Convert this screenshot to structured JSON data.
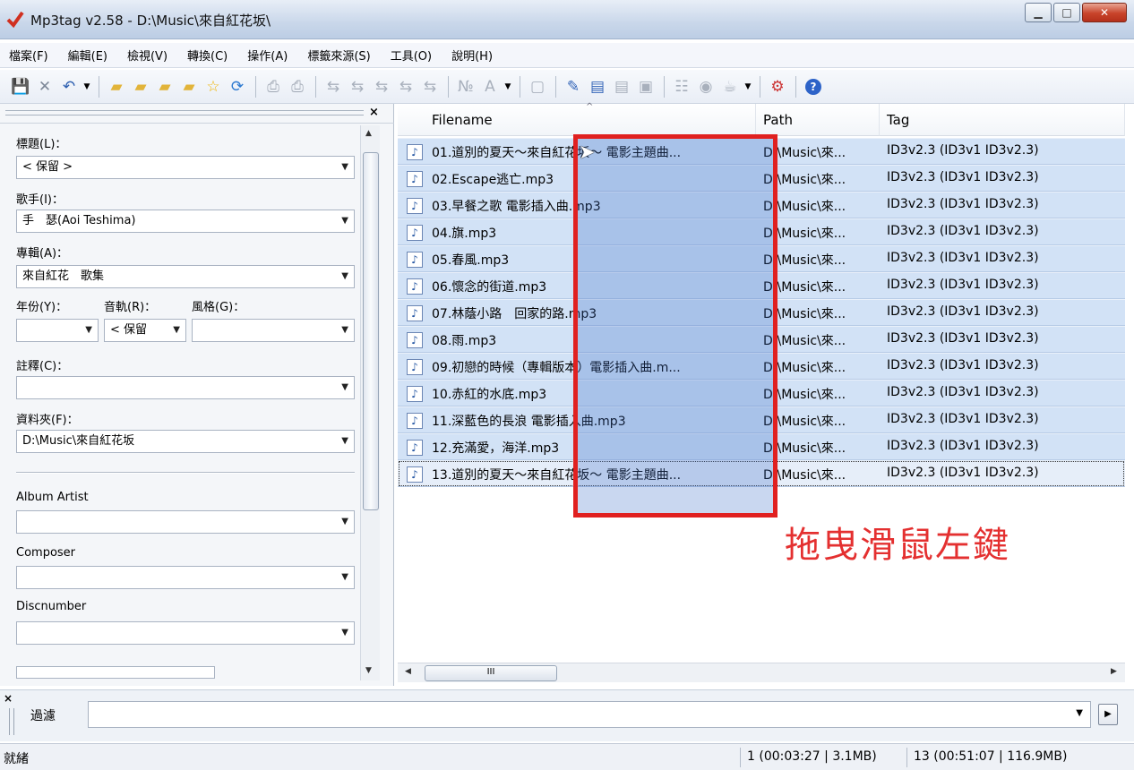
{
  "window": {
    "title": "Mp3tag v2.58  -  D:\\Music\\來自紅花坂\\",
    "minimize": "▁",
    "maximize": "□",
    "close": "✕"
  },
  "menu": [
    "檔案(F)",
    "編輯(E)",
    "檢視(V)",
    "轉換(C)",
    "操作(A)",
    "標籤來源(S)",
    "工具(O)",
    "說明(H)"
  ],
  "toolbar_icons": [
    "save-icon",
    "remove-tag-icon",
    "undo-icon",
    "undo-dropdown-icon",
    "change-directory-icon",
    "add-directory-icon",
    "open-folder-icon",
    "add-folder-icon",
    "favorites-icon",
    "refresh-icon",
    "print-icon",
    "print2-icon",
    "tag-filename-icon",
    "filename-tag-icon",
    "filename-filename-icon",
    "text-file-tag-icon",
    "tag-tag-icon",
    "autonumber-icon",
    "case-conversion-icon",
    "case-dropdown-icon",
    "extended-tags-icon",
    "actions-icon",
    "export-icon",
    "import-icon",
    "playlist-icon",
    "web-source-icon",
    "cd-icon",
    "coffee-icon",
    "coffee-dropdown-icon",
    "options-icon",
    "help-icon"
  ],
  "left_panel": {
    "close": "×",
    "title_label": "標題(L)：",
    "title_value": "< 保留 >",
    "artist_label": "歌手(I)：",
    "artist_value": "手　瑟(Aoi Teshima)",
    "album_label": "專輯(A)：",
    "album_value": "來自紅花　歌集",
    "year_label": "年份(Y)：",
    "track_label": "音軌(R)：",
    "genre_label": "風格(G)：",
    "track_value": "< 保留",
    "comment_label": "註釋(C)：",
    "directory_label": "資料夾(F)：",
    "directory_value": "D:\\Music\\來自紅花坂",
    "album_artist_label": "Album Artist",
    "composer_label": "Composer",
    "discnumber_label": "Discnumber"
  },
  "file_list": {
    "columns": [
      "Filename",
      "Path",
      "Tag"
    ],
    "rows": [
      {
        "filename": "01.道別的夏天～來自紅花坂～ 電影主題曲...",
        "path": "D:\\Music\\來...",
        "tag": "ID3v2.3 (ID3v1 ID3v2.3)"
      },
      {
        "filename": "02.Escape逃亡.mp3",
        "path": "D:\\Music\\來...",
        "tag": "ID3v2.3 (ID3v1 ID3v2.3)"
      },
      {
        "filename": "03.早餐之歌 電影插入曲.mp3",
        "path": "D:\\Music\\來...",
        "tag": "ID3v2.3 (ID3v1 ID3v2.3)"
      },
      {
        "filename": "04.旗.mp3",
        "path": "D:\\Music\\來...",
        "tag": "ID3v2.3 (ID3v1 ID3v2.3)"
      },
      {
        "filename": "05.春風.mp3",
        "path": "D:\\Music\\來...",
        "tag": "ID3v2.3 (ID3v1 ID3v2.3)"
      },
      {
        "filename": "06.懷念的街道.mp3",
        "path": "D:\\Music\\來...",
        "tag": "ID3v2.3 (ID3v1 ID3v2.3)"
      },
      {
        "filename": "07.林蔭小路　回家的路.mp3",
        "path": "D:\\Music\\來...",
        "tag": "ID3v2.3 (ID3v1 ID3v2.3)"
      },
      {
        "filename": "08.雨.mp3",
        "path": "D:\\Music\\來...",
        "tag": "ID3v2.3 (ID3v1 ID3v2.3)"
      },
      {
        "filename": "09.初戀的時候（專輯版本）電影插入曲.m...",
        "path": "D:\\Music\\來...",
        "tag": "ID3v2.3 (ID3v1 ID3v2.3)"
      },
      {
        "filename": "10.赤紅的水底.mp3",
        "path": "D:\\Music\\來...",
        "tag": "ID3v2.3 (ID3v1 ID3v2.3)"
      },
      {
        "filename": "11.深藍色的長浪 電影插入曲.mp3",
        "path": "D:\\Music\\來...",
        "tag": "ID3v2.3 (ID3v1 ID3v2.3)"
      },
      {
        "filename": "12.充滿愛，海洋.mp3",
        "path": "D:\\Music\\來...",
        "tag": "ID3v2.3 (ID3v1 ID3v2.3)"
      },
      {
        "filename": "13.道別的夏天～來自紅花坂～ 電影主題曲...",
        "path": "D:\\Music\\來...",
        "tag": "ID3v2.3 (ID3v1 ID3v2.3)"
      }
    ],
    "hscroll_grip": "III"
  },
  "annotation": "拖曳滑鼠左鍵",
  "filter": {
    "close": "×",
    "label": "過濾",
    "value": ""
  },
  "status": {
    "ready": "就緒",
    "selected": "1 (00:03:27 | 3.1MB)",
    "total": "13 (00:51:07 | 116.9MB)"
  },
  "colors": {
    "selection": "#d2e2f6",
    "annotation_red": "#e02020"
  }
}
